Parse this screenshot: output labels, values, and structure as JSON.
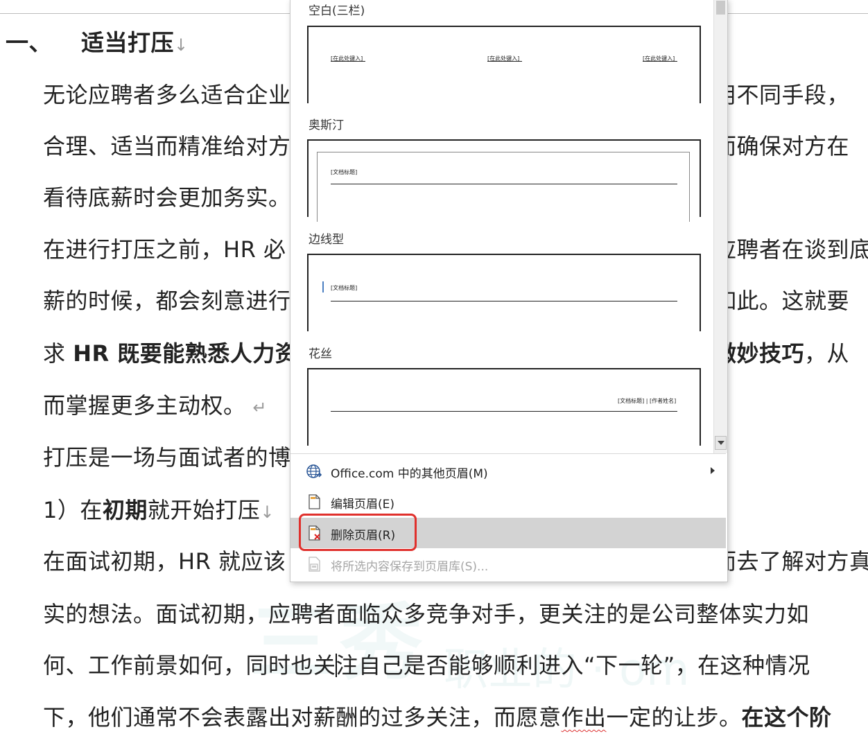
{
  "document": {
    "heading": {
      "number": "一、",
      "text": "适当打压",
      "mark": "↓"
    },
    "lines": [
      {
        "left": "无论应聘者多么适合企业",
        "right": "用不同手段，"
      },
      {
        "left": "合理、适当而精准给对方",
        "right": "而确保对方在"
      },
      {
        "left": "看待底薪时会更加务实。"
      },
      {
        "left": "在进行打压之前，HR 必",
        "right": "应聘者在谈到底"
      },
      {
        "left": "薪的时候，都会刻意进行",
        "right": "如此。这就要"
      },
      {
        "left_prefix": "求 ",
        "left_bold": "HR 既要能熟悉人力资",
        "right_bold": "微妙技巧",
        "right_tail": "，从"
      },
      {
        "left": "而掌握更多主动权。",
        "mark": "↵"
      },
      {
        "left": "打压是一场与面试者的博"
      },
      {
        "left_prefix": "1）在",
        "left_bold": "初期",
        "left_tail": "就开始打压",
        "mark": "↓"
      },
      {
        "left": "在面试初期，HR 就应该",
        "right": "而去了解对方真"
      }
    ],
    "full_lines": [
      {
        "text": "实的想法。面试初期，应聘者面临众多竞争对手，更关注的是公司整体实力如"
      },
      {
        "before_caret": "何、工作前景如何，同时也关",
        "after_caret": "注自己是否能够顺利进入“下一轮”，在这种情况"
      },
      {
        "before": "下，他们通常不会表露出对薪酬的过多关注，而愿意",
        "squiggle": "作出",
        "after": "一定的让步。",
        "bold": "在这个阶"
      }
    ],
    "watermark": {
      "main": "三秀",
      "sub": "职业的 ·  om"
    }
  },
  "gallery": {
    "sections": [
      {
        "label": "空白(三栏)",
        "placeholders": [
          "[在此处键入]",
          "[在此处键入]",
          "[在此处键入]"
        ]
      },
      {
        "label": "奥斯汀",
        "placeholders": [
          "[文档标题]"
        ]
      },
      {
        "label": "边线型",
        "placeholders": [
          "[文档标题]"
        ]
      },
      {
        "label": "花丝",
        "placeholders": [
          "[文档标题] | [作者姓名]"
        ]
      }
    ]
  },
  "menu": {
    "items": [
      {
        "label": "Office.com 中的其他页眉(M)",
        "icon": "globe-icon",
        "enabled": true,
        "submenu": true
      },
      {
        "label": "编辑页眉(E)",
        "icon": "edit-header-icon",
        "enabled": true
      },
      {
        "label": "删除页眉(R)",
        "icon": "remove-header-icon",
        "enabled": true,
        "highlighted": true
      },
      {
        "label": "将所选内容保存到页眉库(S)...",
        "icon": "save-selection-icon",
        "enabled": false
      }
    ]
  },
  "colors": {
    "highlight_border": "#e0302c",
    "hover_bg": "#d3d3d3",
    "disabled_text": "#a6a6a6"
  }
}
